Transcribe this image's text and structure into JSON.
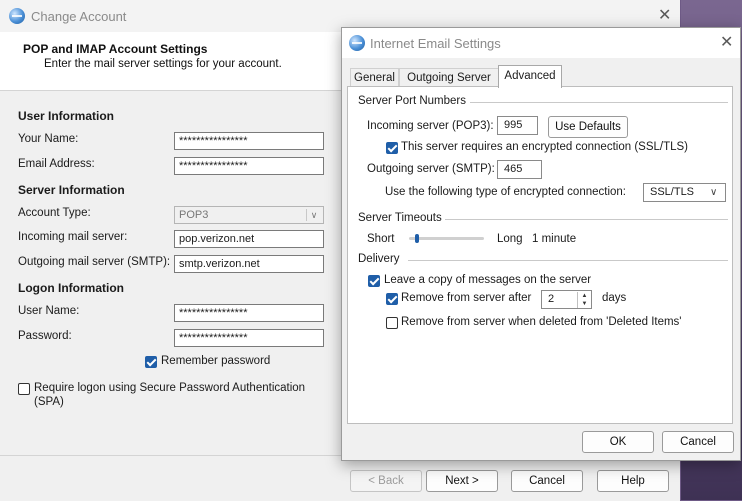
{
  "change_account": {
    "title": "Change Account",
    "header_title": "POP and IMAP Account Settings",
    "header_subtitle": "Enter the mail server settings for your account.",
    "user_info": {
      "heading": "User Information",
      "your_name_label": "Your Name:",
      "your_name_value": "****************",
      "email_label": "Email Address:",
      "email_value": "****************"
    },
    "server_info": {
      "heading": "Server Information",
      "account_type_label": "Account Type:",
      "account_type_value": "POP3",
      "incoming_label": "Incoming mail server:",
      "incoming_value": "pop.verizon.net",
      "outgoing_label": "Outgoing mail server (SMTP):",
      "outgoing_value": "smtp.verizon.net"
    },
    "logon_info": {
      "heading": "Logon Information",
      "username_label": "User Name:",
      "username_value": "****************",
      "password_label": "Password:",
      "password_value": "****************",
      "remember_password_label": "Remember password",
      "remember_password_checked": true,
      "spa_label": "Require logon using Secure Password Authentication (SPA)",
      "spa_checked": false
    },
    "footer": {
      "back_label": "< Back",
      "next_label": "Next >",
      "cancel_label": "Cancel",
      "help_label": "Help"
    }
  },
  "email_settings": {
    "title": "Internet Email Settings",
    "tabs": [
      {
        "label": "General",
        "active": false
      },
      {
        "label": "Outgoing Server",
        "active": false
      },
      {
        "label": "Advanced",
        "active": true
      }
    ],
    "server_ports": {
      "heading": "Server Port Numbers",
      "incoming_label": "Incoming server (POP3):",
      "incoming_port": "995",
      "use_defaults_label": "Use Defaults",
      "ssl_required_label": "This server requires an encrypted connection (SSL/TLS)",
      "ssl_required_checked": true,
      "outgoing_label": "Outgoing server (SMTP):",
      "outgoing_port": "465",
      "encryption_label": "Use the following type of encrypted connection:",
      "encryption_value": "SSL/TLS"
    },
    "timeouts": {
      "heading": "Server Timeouts",
      "short_label": "Short",
      "long_label": "Long",
      "value_label": "1 minute",
      "slider_fraction": 0.08
    },
    "delivery": {
      "heading": "Delivery",
      "leave_copy_label": "Leave a copy of messages on the server",
      "leave_copy_checked": true,
      "remove_after_label": "Remove from server after",
      "remove_after_checked": true,
      "remove_after_days": "2",
      "days_label": "days",
      "remove_deleted_label": "Remove from server when deleted from 'Deleted Items'",
      "remove_deleted_checked": false
    },
    "ok_label": "OK",
    "cancel_label": "Cancel"
  },
  "icons": [
    "app-globe-icon",
    "close-icon",
    "checkbox-check-icon",
    "chevron-down-icon",
    "spin-up-icon",
    "spin-down-icon"
  ]
}
